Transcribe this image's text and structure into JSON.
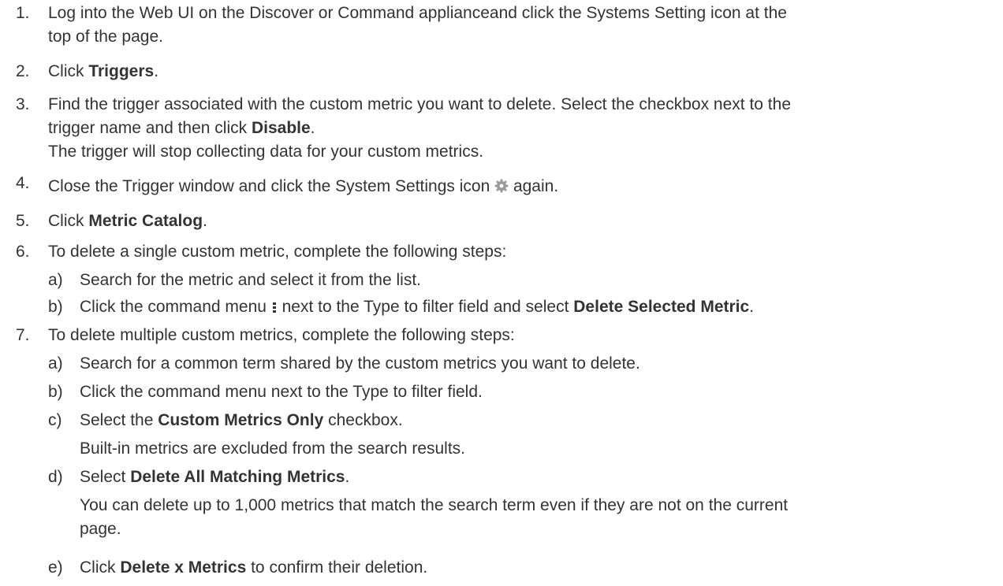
{
  "steps": [
    {
      "num": "1.",
      "t1": "Log into the Web UI on the Discover or Command applianceand click the Systems Setting icon at the",
      "t2": "top of the page."
    },
    {
      "num": "2.",
      "pre": "Click ",
      "bold": "Triggers",
      "post": "."
    },
    {
      "num": "3.",
      "t1": "Find the trigger associated with the custom metric you want to delete. Select the checkbox next to the",
      "t2pre": "trigger name and then click ",
      "t2bold": "Disable",
      "t2post": ".",
      "t3": "The trigger will stop collecting data for your custom metrics."
    },
    {
      "num": "4.",
      "pre": "Close the Trigger window and click the System Settings icon ",
      "post": " again.",
      "icon": "gear-icon"
    },
    {
      "num": "5.",
      "pre": "Click ",
      "bold": "Metric Catalog",
      "post": "."
    },
    {
      "num": "6.",
      "text": "To delete a single custom metric, complete the following steps:",
      "subs": [
        {
          "letter": "a)",
          "text": "Search for the metric and select it from the list."
        },
        {
          "letter": "b)",
          "pre": "Click the command menu ",
          "mid": " next to the Type to filter field and select ",
          "bold": "Delete Selected Metric",
          "post": ".",
          "icon": "kebab-menu-icon"
        }
      ]
    },
    {
      "num": "7.",
      "text": "To delete multiple custom metrics, complete the following steps:",
      "subs": [
        {
          "letter": "a)",
          "text": "Search for a common term shared by the custom metrics you want to delete."
        },
        {
          "letter": "b)",
          "text": "Click the command menu next to the Type to filter field."
        },
        {
          "letter": "c)",
          "pre": "Select the ",
          "bold": "Custom Metrics Only",
          "post": " checkbox.",
          "note": "Built-in metrics are excluded from the search results."
        },
        {
          "letter": "d)",
          "pre": "Select ",
          "bold": "Delete All Matching Metrics",
          "post": ".",
          "note1": "You can delete up to 1,000 metrics that match the search term even if they are not on the current",
          "note2": "page."
        },
        {
          "letter": "e)",
          "pre": "Click ",
          "bold": "Delete x Metrics",
          "post": " to confirm their deletion."
        }
      ]
    }
  ]
}
